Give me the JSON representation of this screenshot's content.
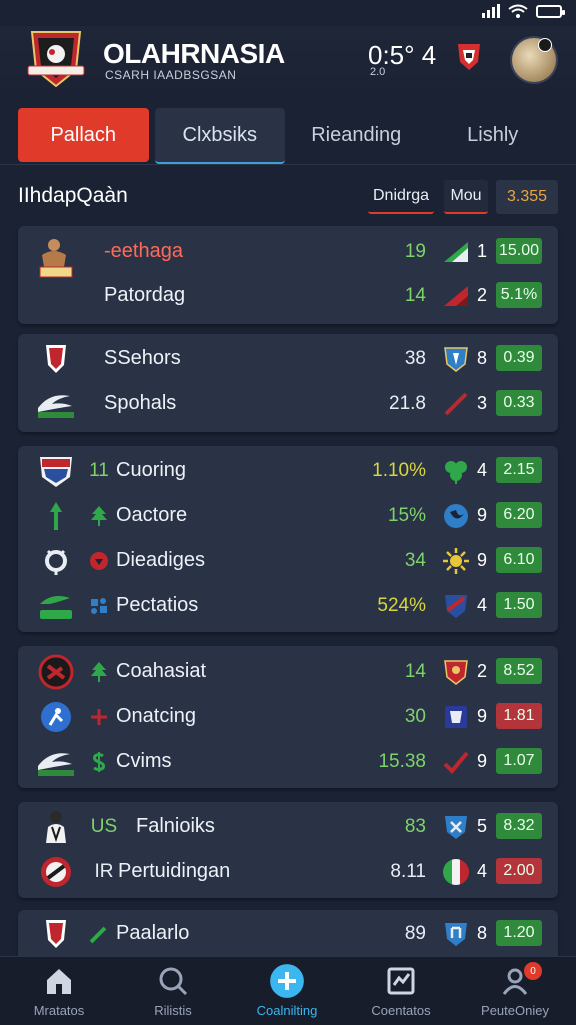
{
  "header": {
    "app_title": "OLAHRNASIA",
    "app_subtitle": "CSARH IAADBSGSAN",
    "time": "0:5° 4",
    "time_sub": "2.0"
  },
  "tabs": [
    {
      "label": "Pallach"
    },
    {
      "label": "Clxbsiks"
    },
    {
      "label": "Rieanding"
    },
    {
      "label": "Lishly"
    }
  ],
  "section": {
    "title": "IIhdapQaàn",
    "sort_a": "Dnidrga",
    "sort_b": "Mou",
    "sort_c": "3.355"
  },
  "cards": [
    {
      "rows": [
        {
          "name": "-eethaga",
          "name_color": "#ff6a5a",
          "num": "19",
          "num_color": "#7ed36a",
          "rank": "1",
          "val": "15.00",
          "val_tone": "g"
        },
        {
          "name": "Patordag",
          "num": "14",
          "num_color": "#7ed36a",
          "rank": "2",
          "val": "5.1%",
          "val_tone": "g"
        }
      ]
    },
    {
      "rows": [
        {
          "name": "SSehors",
          "num": "38",
          "num_color": "#e8ecf3",
          "rank": "8",
          "val": "0.39",
          "val_tone": "g"
        },
        {
          "name": "Spohals",
          "num": "21.8",
          "num_color": "#e8ecf3",
          "rank": "3",
          "val": "0.33",
          "val_tone": "g"
        }
      ]
    },
    {
      "rows": [
        {
          "prefix": "11",
          "name": "Cuoring",
          "num": "1.10%",
          "num_color": "#d7d640",
          "rank": "4",
          "val": "2.15",
          "val_tone": "g"
        },
        {
          "name": "Oactore",
          "num": "15%",
          "num_color": "#7ed36a",
          "rank": "9",
          "val": "6.20",
          "val_tone": "g"
        },
        {
          "name": "Dieadiges",
          "num": "34",
          "num_color": "#7ed36a",
          "rank": "9",
          "val": "6.10",
          "val_tone": "g"
        },
        {
          "name": "Pectatios",
          "num": "524%",
          "num_color": "#d7d640",
          "rank": "4",
          "val": "1.50",
          "val_tone": "g"
        }
      ]
    },
    {
      "rows": [
        {
          "name": "Coahasiat",
          "num": "14",
          "num_color": "#7ed36a",
          "rank": "2",
          "val": "8.52",
          "val_tone": "g"
        },
        {
          "name": "Onatcing",
          "num": "30",
          "num_color": "#7ed36a",
          "rank": "9",
          "val": "1.81",
          "val_tone": "r"
        },
        {
          "name": "Cvims",
          "num": "15.38",
          "num_color": "#7ed36a",
          "rank": "9",
          "val": "1.07",
          "val_tone": "g"
        }
      ]
    },
    {
      "rows": [
        {
          "prefix": "US",
          "name": "Falnioiks",
          "num": "83",
          "num_color": "#7ed36a",
          "rank": "5",
          "val": "8.32",
          "val_tone": "g"
        },
        {
          "prefix": "IR",
          "name": "Pertuidingan",
          "num": "8.11",
          "num_color": "#e8ecf3",
          "rank": "4",
          "val": "2.00",
          "val_tone": "r"
        }
      ]
    },
    {
      "rows": [
        {
          "name": "Paalarlo",
          "num": "89",
          "num_color": "#e8ecf3",
          "rank": "8",
          "val": "1.20",
          "val_tone": "g"
        }
      ]
    }
  ],
  "nav": [
    {
      "label": "Mratatos",
      "icon": "home-icon"
    },
    {
      "label": "Rilistis",
      "icon": "search-icon"
    },
    {
      "label": "Coalnilting",
      "icon": "add-icon"
    },
    {
      "label": "Coentatos",
      "icon": "scoreboard-icon"
    },
    {
      "label": "PeuteOniey",
      "icon": "profile-icon"
    }
  ],
  "notif_count": "0",
  "colors": {
    "accent_red": "#e03a2b",
    "accent_blue": "#3cb6ee",
    "positive": "#2f8a3c",
    "negative": "#b3343b"
  }
}
